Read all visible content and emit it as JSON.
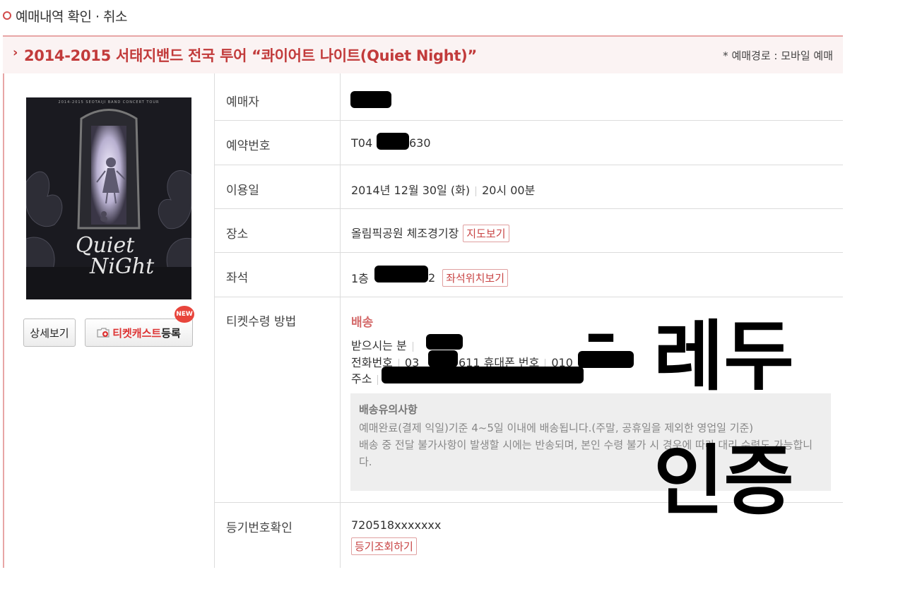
{
  "section_title": "예매내역 확인 · 취소",
  "booking": {
    "arrow": "›",
    "title": "2014-2015 서태지밴드 전국 투어 “콰이어트 나이트(Quiet Night)”",
    "route": "* 예매경로 : 모바일 예매"
  },
  "poster": {
    "tagline": "2014-2015 SEOTAIJI BAND CONCERT TOUR",
    "logo_line1": "Quiet",
    "logo_line2": "NiGht"
  },
  "buttons": {
    "detail": "상세보기",
    "ticketcast_red": "티켓캐스트",
    "ticketcast_black": "등록",
    "new_badge": "NEW"
  },
  "rows": {
    "booker": {
      "label": "예매자"
    },
    "reservation": {
      "label": "예약번호",
      "prefix": "T04",
      "suffix": "630"
    },
    "date": {
      "label": "이용일",
      "date": "2014년 12월 30일 (화)",
      "time": "20시 00분"
    },
    "venue": {
      "label": "장소",
      "value": "올림픽공원 체조경기장",
      "map_button": "지도보기"
    },
    "seat": {
      "label": "좌석",
      "prefix": "1층",
      "suffix": "2",
      "seat_button": "좌석위치보기"
    },
    "ticket": {
      "label": "티켓수령 방법",
      "method": "배송",
      "receiver_label": "받으시는 분",
      "phone_label": "전화번호",
      "phone_prefix": "03",
      "phone_suffix": "611",
      "mobile_label": "휴대폰 번호",
      "mobile_prefix": "010",
      "address_label": "주소",
      "notice_title": "배송유의사항",
      "notice_line1": "예매완료(결제 익일)기준 4~5일 이내에 배송됩니다.(주말, 공휴일을 제외한 영업일 기준)",
      "notice_line2": "배송 중 전달 불가사항이 발생할 시에는 반송되며, 본인 수령 불가 시 경우에 따라 대리 수령도 가능합니다."
    },
    "registry": {
      "label": "등기번호확인",
      "value": "720518xxxxxxx",
      "button": "등기조회하기"
    }
  },
  "overlay": {
    "dash": "–",
    "line1": "레두",
    "line2": "인증"
  }
}
